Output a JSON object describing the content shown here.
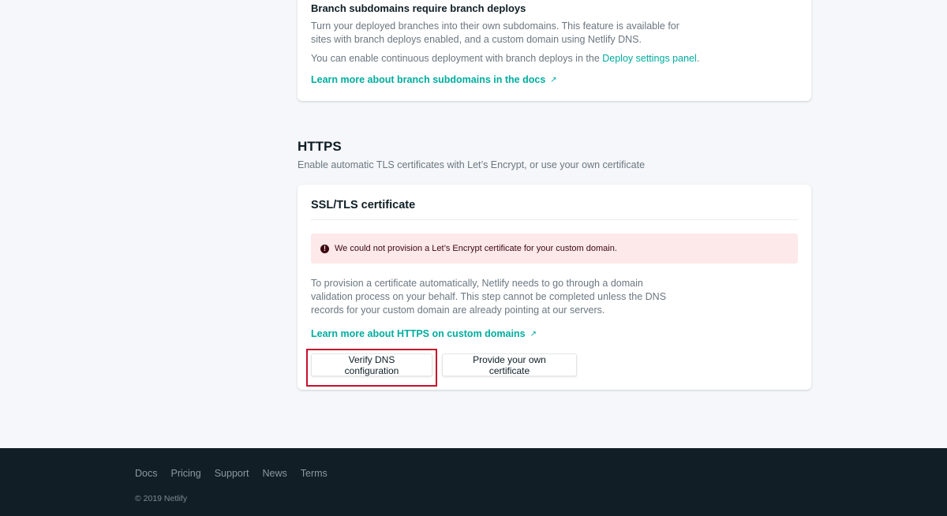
{
  "branch_subdomains": {
    "title": "Branch subdomains require branch deploys",
    "description": "Turn your deployed branches into their own subdomains. This feature is available for sites with branch deploys enabled, and a custom domain using Netlify DNS.",
    "deploy_text": "You can enable continuous deployment with branch deploys in the",
    "deploy_link": "Deploy settings panel",
    "deploy_suffix": ".",
    "learn_more": "Learn more about branch subdomains in the docs"
  },
  "https": {
    "title": "HTTPS",
    "subtitle": "Enable automatic TLS certificates with Let’s Encrypt, or use your own certificate"
  },
  "ssl": {
    "title": "SSL/TLS certificate",
    "alert_icon": "!",
    "alert": "We could not provision a Let’s Encrypt certificate for your custom domain.",
    "description": "To provision a certificate automatically, Netlify needs to go through a domain validation process on your behalf. This step cannot be completed unless the DNS records for your custom domain are already pointing at our servers.",
    "learn_more": "Learn more about HTTPS on custom domains",
    "verify_button": "Verify DNS configuration",
    "provide_button": "Provide your own certificate"
  },
  "icons": {
    "external_link": "↗"
  },
  "footer": {
    "links": [
      "Docs",
      "Pricing",
      "Support",
      "News",
      "Terms"
    ],
    "copyright": "© 2019 Netlify"
  },
  "colors": {
    "accent": "#00ad9f",
    "alert_bg": "#fde8ea",
    "footer_bg": "#111e25",
    "highlight": "#c8102e"
  }
}
